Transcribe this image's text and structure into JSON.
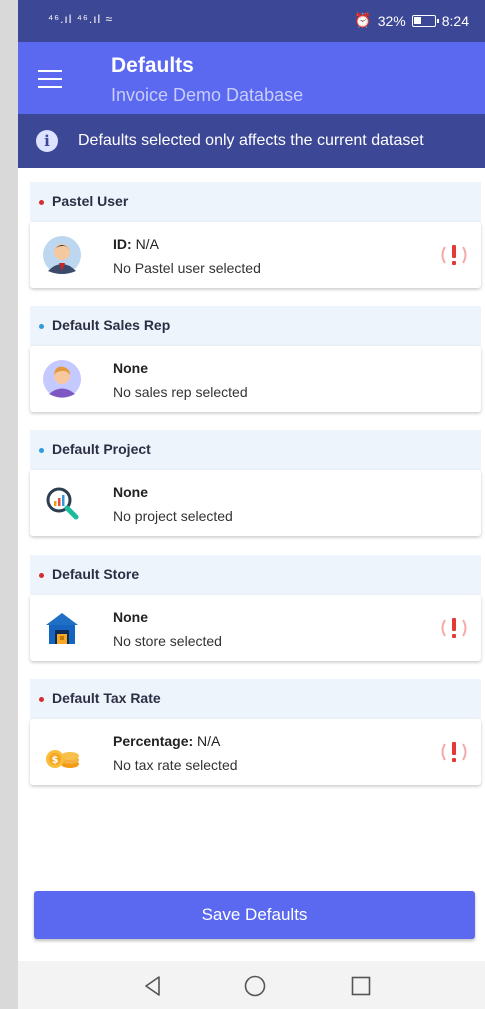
{
  "status_bar": {
    "signal": "⁴⁶.ıl ⁴⁶.ıl ≈",
    "battery": "32%",
    "time": "8:24"
  },
  "header": {
    "title": "Defaults",
    "subtitle": "Invoice Demo Database"
  },
  "info_banner": {
    "text": "Defaults selected only affects the current dataset",
    "icon": "info-icon"
  },
  "sections": [
    {
      "title": "Pastel User",
      "dot_color": "#d32f2f",
      "label": "ID:",
      "value": "N/A",
      "detail": "No Pastel user selected",
      "warning": true,
      "icon": "user-avatar-icon"
    },
    {
      "title": "Default Sales Rep",
      "dot_color": "#2c9be0",
      "label": "None",
      "value": "",
      "detail": "No sales rep selected",
      "warning": false,
      "icon": "sales-rep-avatar-icon"
    },
    {
      "title": "Default Project",
      "dot_color": "#2c9be0",
      "label": "None",
      "value": "",
      "detail": "No project selected",
      "warning": false,
      "icon": "project-search-icon"
    },
    {
      "title": "Default Store",
      "dot_color": "#d32f2f",
      "label": "None",
      "value": "",
      "detail": "No store selected",
      "warning": true,
      "icon": "store-icon"
    },
    {
      "title": "Default Tax Rate",
      "dot_color": "#d32f2f",
      "label": "Percentage:",
      "value": "N/A",
      "detail": "No tax rate selected",
      "warning": true,
      "icon": "coins-icon"
    }
  ],
  "save_button": {
    "label": "Save Defaults"
  },
  "colors": {
    "accent": "#5a69f0",
    "dark": "#3c4796",
    "warning": "#e53935"
  }
}
